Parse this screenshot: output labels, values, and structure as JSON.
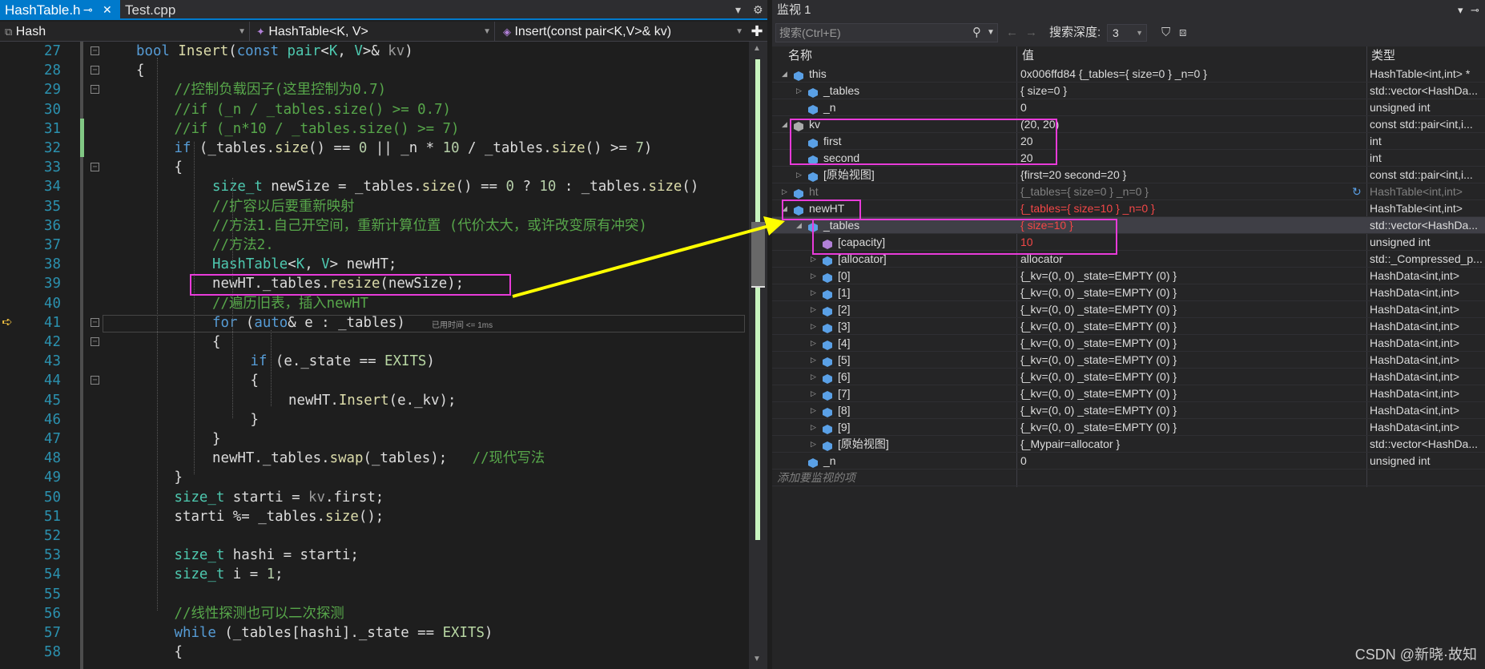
{
  "tabs": [
    {
      "label": "HashTable.h",
      "active": true
    },
    {
      "label": "Test.cpp",
      "active": false
    }
  ],
  "nav": {
    "scope": "Hash",
    "class": "HashTable<K, V>",
    "member": "Insert(const pair<K,V>& kv)"
  },
  "code_lines": [
    {
      "n": "27",
      "indent": 1,
      "html": "<span class='kw'>bool</span> <span class='fn'>Insert</span>(<span class='kw'>const</span> <span class='ty'>pair</span>&lt;<span class='ty'>K</span>, <span class='ty'>V</span>&gt;&amp; <span class='pm'>kv</span>)"
    },
    {
      "n": "28",
      "indent": 1,
      "html": "{"
    },
    {
      "n": "29",
      "indent": 2,
      "html": "<span class='cm'>//控制负载因子(这里控制为0.7)</span>"
    },
    {
      "n": "30",
      "indent": 2,
      "html": "<span class='cm'>//if (_n / _tables.size() &gt;= 0.7)</span>"
    },
    {
      "n": "31",
      "indent": 2,
      "html": "<span class='cm'>//if (_n*10 / _tables.size() &gt;= 7)</span>"
    },
    {
      "n": "32",
      "indent": 2,
      "html": "<span class='kw'>if</span> (_tables.<span class='fn'>size</span>() == <span class='nm'>0</span> || _n * <span class='nm'>10</span> / _tables.<span class='fn'>size</span>() &gt;= <span class='nm'>7</span>)"
    },
    {
      "n": "33",
      "indent": 2,
      "html": "{"
    },
    {
      "n": "34",
      "indent": 3,
      "html": "<span class='ty'>size_t</span> newSize = _tables.<span class='fn'>size</span>() == <span class='nm'>0</span> ? <span class='nm'>10</span> : _tables.<span class='fn'>size</span>()"
    },
    {
      "n": "35",
      "indent": 3,
      "html": "<span class='cm'>//扩容以后要重新映射</span>"
    },
    {
      "n": "36",
      "indent": 3,
      "html": "<span class='cm'>//方法1.自己开空间，重新计算位置 (代价太大，或许改变原有冲突)</span>"
    },
    {
      "n": "37",
      "indent": 3,
      "html": "<span class='cm'>//方法2.</span>"
    },
    {
      "n": "38",
      "indent": 3,
      "html": "<span class='ty'>HashTable</span>&lt;<span class='ty'>K</span>, <span class='ty'>V</span>&gt; newHT;"
    },
    {
      "n": "39",
      "indent": 3,
      "html": "newHT._tables.<span class='fn'>resize</span>(newSize);"
    },
    {
      "n": "40",
      "indent": 3,
      "html": "<span class='cm'>//遍历旧表，插入newHT</span>"
    },
    {
      "n": "41",
      "indent": 3,
      "html": "<span class='kw'>for</span> (<span class='kw'>auto</span>&amp; e : _tables)"
    },
    {
      "n": "42",
      "indent": 3,
      "html": "{"
    },
    {
      "n": "43",
      "indent": 4,
      "html": "<span class='kw'>if</span> (e._state == <span class='en'>EXITS</span>)"
    },
    {
      "n": "44",
      "indent": 4,
      "html": "{"
    },
    {
      "n": "45",
      "indent": 5,
      "html": "newHT.<span class='fn'>Insert</span>(e._kv);"
    },
    {
      "n": "46",
      "indent": 4,
      "html": "}"
    },
    {
      "n": "47",
      "indent": 3,
      "html": "}"
    },
    {
      "n": "48",
      "indent": 3,
      "html": "newHT._tables.<span class='fn'>swap</span>(_tables);   <span class='cm'>//现代写法</span>"
    },
    {
      "n": "49",
      "indent": 2,
      "html": "}"
    },
    {
      "n": "50",
      "indent": 2,
      "html": "<span class='ty'>size_t</span> starti = <span class='pm'>kv</span>.first;"
    },
    {
      "n": "51",
      "indent": 2,
      "html": "starti %= _tables.<span class='fn'>size</span>();"
    },
    {
      "n": "52",
      "indent": 2,
      "html": ""
    },
    {
      "n": "53",
      "indent": 2,
      "html": "<span class='ty'>size_t</span> hashi = starti;"
    },
    {
      "n": "54",
      "indent": 2,
      "html": "<span class='ty'>size_t</span> i = <span class='nm'>1</span>;"
    },
    {
      "n": "55",
      "indent": 2,
      "html": ""
    },
    {
      "n": "56",
      "indent": 2,
      "html": "<span class='cm'>//线性探测也可以二次探测</span>"
    },
    {
      "n": "57",
      "indent": 2,
      "html": "<span class='kw'>while</span> (_tables[hashi]._state == <span class='en'>EXITS</span>)"
    },
    {
      "n": "58",
      "indent": 2,
      "html": "{"
    }
  ],
  "perf_tip": "已用时间 <= 1ms",
  "watch": {
    "title": "监视 1",
    "search_placeholder": "搜索(Ctrl+E)",
    "depth_label": "搜索深度:",
    "depth_value": "3",
    "col_name": "名称",
    "col_value": "值",
    "col_type": "类型",
    "rows": [
      {
        "level": 0,
        "exp": "◢",
        "icon": "obj",
        "name": "this",
        "value": "0x006ffd84 {_tables={ size=0 } _n=0 }",
        "type": "HashTable<int,int> *"
      },
      {
        "level": 1,
        "exp": "▷",
        "icon": "field",
        "name": "_tables",
        "value": "{ size=0 }",
        "type": "std::vector<HashDa..."
      },
      {
        "level": 1,
        "exp": "",
        "icon": "field",
        "name": "_n",
        "value": "0",
        "type": "unsigned int"
      },
      {
        "level": 0,
        "exp": "◢",
        "icon": "struct",
        "name": "kv",
        "value": "(20, 20)",
        "type": "const std::pair<int,i..."
      },
      {
        "level": 1,
        "exp": "",
        "icon": "obj",
        "name": "first",
        "value": "20",
        "type": "int"
      },
      {
        "level": 1,
        "exp": "",
        "icon": "obj",
        "name": "second",
        "value": "20",
        "type": "int"
      },
      {
        "level": 1,
        "exp": "▷",
        "icon": "obj",
        "name": "[原始视图]",
        "value": "{first=20 second=20 }",
        "type": "const std::pair<int,i..."
      },
      {
        "level": 0,
        "exp": "▷",
        "icon": "obj",
        "name": "ht",
        "value": "{_tables={ size=0 } _n=0 }",
        "type": "HashTable<int,int>",
        "dim": true,
        "refresh": true
      },
      {
        "level": 0,
        "exp": "◢",
        "icon": "obj",
        "name": "newHT",
        "value": "{_tables={ size=10 } _n=0 }",
        "type": "HashTable<int,int>",
        "red": true
      },
      {
        "level": 1,
        "exp": "◢",
        "icon": "field",
        "name": "_tables",
        "value": "{ size=10 }",
        "type": "std::vector<HashDa...",
        "red": true,
        "sel": true
      },
      {
        "level": 2,
        "exp": "",
        "icon": "prop",
        "name": "[capacity]",
        "value": "10",
        "type": "unsigned int",
        "red": true
      },
      {
        "level": 2,
        "exp": "▷",
        "icon": "obj",
        "name": "[allocator]",
        "value": "allocator",
        "type": "std::_Compressed_p..."
      },
      {
        "level": 2,
        "exp": "▷",
        "icon": "obj",
        "name": "[0]",
        "value": "{_kv=(0, 0) _state=EMPTY (0) }",
        "type": "HashData<int,int>"
      },
      {
        "level": 2,
        "exp": "▷",
        "icon": "obj",
        "name": "[1]",
        "value": "{_kv=(0, 0) _state=EMPTY (0) }",
        "type": "HashData<int,int>"
      },
      {
        "level": 2,
        "exp": "▷",
        "icon": "obj",
        "name": "[2]",
        "value": "{_kv=(0, 0) _state=EMPTY (0) }",
        "type": "HashData<int,int>"
      },
      {
        "level": 2,
        "exp": "▷",
        "icon": "obj",
        "name": "[3]",
        "value": "{_kv=(0, 0) _state=EMPTY (0) }",
        "type": "HashData<int,int>"
      },
      {
        "level": 2,
        "exp": "▷",
        "icon": "obj",
        "name": "[4]",
        "value": "{_kv=(0, 0) _state=EMPTY (0) }",
        "type": "HashData<int,int>"
      },
      {
        "level": 2,
        "exp": "▷",
        "icon": "obj",
        "name": "[5]",
        "value": "{_kv=(0, 0) _state=EMPTY (0) }",
        "type": "HashData<int,int>"
      },
      {
        "level": 2,
        "exp": "▷",
        "icon": "obj",
        "name": "[6]",
        "value": "{_kv=(0, 0) _state=EMPTY (0) }",
        "type": "HashData<int,int>"
      },
      {
        "level": 2,
        "exp": "▷",
        "icon": "obj",
        "name": "[7]",
        "value": "{_kv=(0, 0) _state=EMPTY (0) }",
        "type": "HashData<int,int>"
      },
      {
        "level": 2,
        "exp": "▷",
        "icon": "obj",
        "name": "[8]",
        "value": "{_kv=(0, 0) _state=EMPTY (0) }",
        "type": "HashData<int,int>"
      },
      {
        "level": 2,
        "exp": "▷",
        "icon": "obj",
        "name": "[9]",
        "value": "{_kv=(0, 0) _state=EMPTY (0) }",
        "type": "HashData<int,int>"
      },
      {
        "level": 2,
        "exp": "▷",
        "icon": "obj",
        "name": "[原始视图]",
        "value": "{_Mypair=allocator }",
        "type": "std::vector<HashDa..."
      },
      {
        "level": 1,
        "exp": "",
        "icon": "field",
        "name": "_n",
        "value": "0",
        "type": "unsigned int"
      }
    ],
    "add_watch": "添加要监视的项"
  },
  "watermark": "CSDN @新晓·故知",
  "colors": {
    "accent": "#007acc",
    "highlight_box": "#e83bd9",
    "arrow": "#ffff00",
    "changed_value": "#f44747"
  }
}
